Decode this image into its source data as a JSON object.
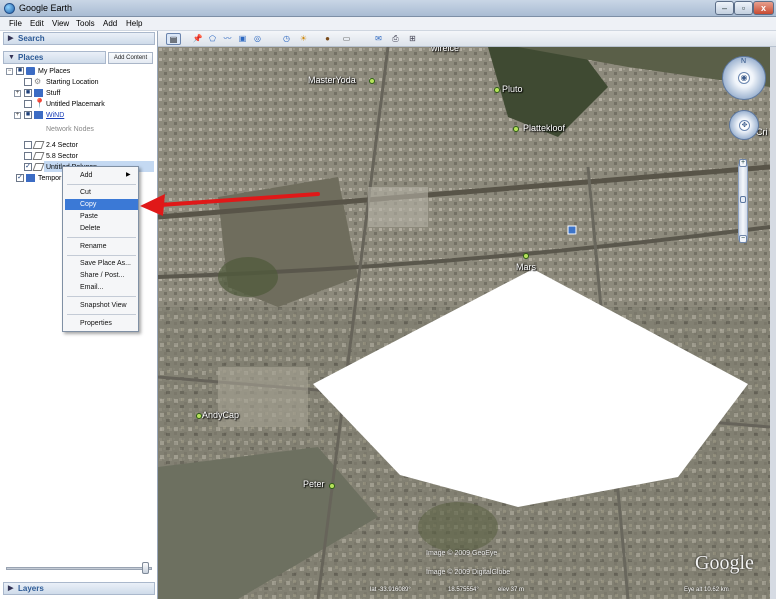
{
  "window": {
    "title": "Google Earth"
  },
  "menu": [
    "File",
    "Edit",
    "View",
    "Tools",
    "Add",
    "Help"
  ],
  "search": {
    "label": "Search"
  },
  "places": {
    "label": "Places",
    "add_content": "Add Content"
  },
  "tree": [
    {
      "label": "My Places",
      "checked": true
    },
    {
      "label": "Starting Location",
      "checked": false
    },
    {
      "label": "Stuff",
      "checked": true
    },
    {
      "label": "Untitled Placemark",
      "checked": false
    },
    {
      "label": "WiND",
      "checked": true
    },
    {
      "label": "Network Nodes",
      "checked": false
    },
    {
      "label": "2.4 Sector",
      "checked": false
    },
    {
      "label": "5.8 Sector",
      "checked": false
    },
    {
      "label": "Untitled Polygon",
      "checked": true
    },
    {
      "label": "Tempor",
      "checked": true
    }
  ],
  "context_menu": {
    "add": "Add",
    "cut": "Cut",
    "copy": "Copy",
    "paste": "Paste",
    "delete": "Delete",
    "rename": "Rename",
    "save_place_as": "Save Place As...",
    "share_post": "Share / Post...",
    "email": "Email...",
    "snapshot_view": "Snapshot View",
    "properties": "Properties"
  },
  "layers": {
    "label": "Layers"
  },
  "map": {
    "labels": {
      "wireice": "wireice",
      "masteryoda": "MasterYoda",
      "pluto": "Pluto",
      "plattekloof": "Plattekloof",
      "mars": "Mars",
      "andycap": "AndyCap",
      "peter": "Peter",
      "cri": "Cri"
    },
    "credits": {
      "geoeye": "Image © 2009 GeoEye",
      "digitalglobe": "Image © 2009 DigitalGlobe",
      "google": "Google"
    },
    "status": {
      "lat": "lat  -33.916089°",
      "lon": "18.575554°",
      "elev": "elev  37 m",
      "eye": "Eye alt  10.62 km"
    }
  },
  "colors": {
    "arrow": "#e01818",
    "selection": "#3b79d6",
    "polygon": "#ffffff",
    "pin": "#b7e35a"
  }
}
